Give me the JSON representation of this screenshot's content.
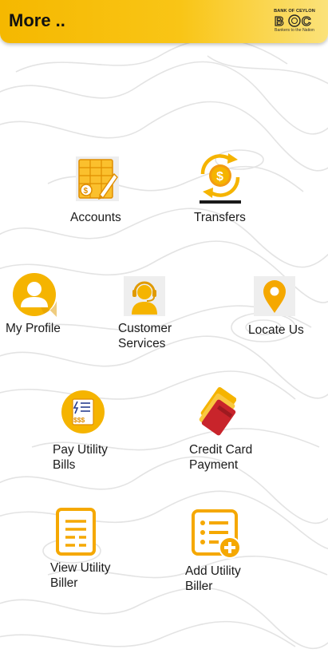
{
  "header": {
    "title": "More ..",
    "logo_top": "BANK OF CEYLON",
    "logo_mark": "BOC",
    "logo_tagline": "Bankers to the Nation"
  },
  "menu": {
    "accounts": {
      "label": "Accounts",
      "icon": "accounts-ledger-icon"
    },
    "transfers": {
      "label": "Transfers",
      "icon": "transfer-coin-icon"
    },
    "my_profile": {
      "label": "My Profile",
      "icon": "user-profile-icon"
    },
    "customer_services": {
      "label_1": "Customer",
      "label_2": "Services",
      "icon": "headset-agent-icon"
    },
    "locate_us": {
      "label": "Locate Us",
      "icon": "map-pin-icon"
    },
    "pay_utility_bills": {
      "label_1": "Pay Utility",
      "label_2": "Bills",
      "icon": "utility-bill-icon"
    },
    "credit_card_payment": {
      "label_1": "Credit Card",
      "label_2": "Payment",
      "icon": "credit-card-icon"
    },
    "view_utility_biller": {
      "label_1": "View Utility",
      "label_2": "Biller",
      "icon": "biller-document-icon"
    },
    "add_utility_biller": {
      "label_1": "Add Utility",
      "label_2": "Biller",
      "icon": "add-biller-icon"
    }
  },
  "colors": {
    "brand": "#f7bd00",
    "icon_orange": "#f39c12",
    "icon_amber": "#f5a800",
    "card_red": "#c8242b"
  }
}
